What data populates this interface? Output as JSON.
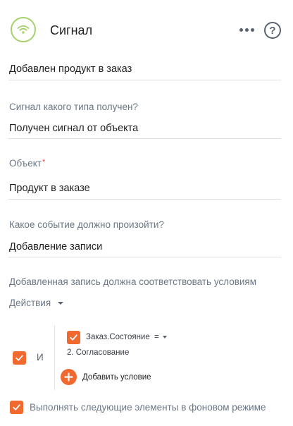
{
  "header": {
    "title": "Сигнал",
    "icon": "wifi-signal-icon",
    "accent": "#a6d06a"
  },
  "name_field": {
    "value": "Добавлен продукт в заказ"
  },
  "signal_type": {
    "label": "Сигнал какого типа получен?",
    "value": "Получен сигнал от объекта"
  },
  "object": {
    "label": "Объект",
    "required_mark": "*",
    "value": "Продукт в заказе"
  },
  "event": {
    "label": "Какое событие должно произойти?",
    "value": "Добавление записи"
  },
  "conditions": {
    "hint": "Добавленная запись должна соответствовать условиям",
    "actions_label": "Действия",
    "group_operator": "И",
    "items": [
      {
        "field": "Заказ.Состояние",
        "operator": "=",
        "value": "2. Согласование"
      }
    ],
    "add_label": "Добавить условие"
  },
  "background_option": {
    "label": "Выполнять следующие элементы в фоновом режиме",
    "checked": true
  },
  "colors": {
    "checkbox": "#f06a2f",
    "label": "#6b7685",
    "required": "#e8433b"
  }
}
